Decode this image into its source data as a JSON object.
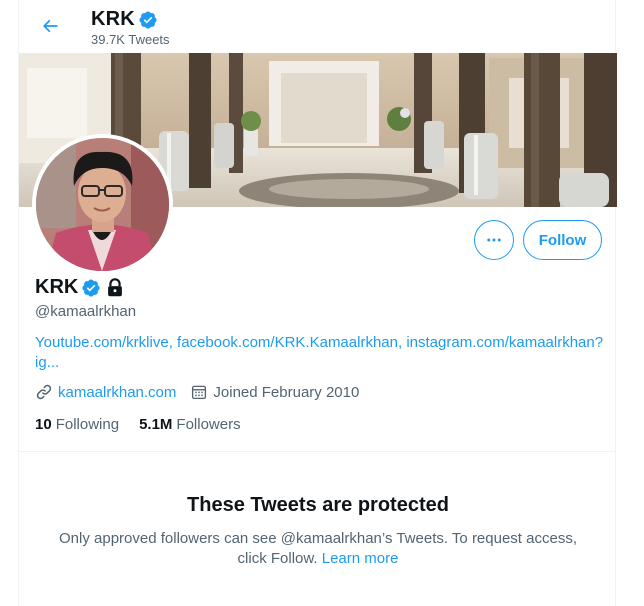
{
  "header": {
    "back_icon": "arrow-left-icon",
    "name": "KRK",
    "tweet_count": "39.7K Tweets"
  },
  "profile": {
    "name": "KRK",
    "handle": "@kamaalrkhan",
    "verified_icon": "verified-badge-icon",
    "lock_icon": "lock-icon",
    "bio_links": [
      "Youtube.com/krklive",
      "facebook.com/KRK.Kamaalrkhan",
      "instagram.com/kamaalrkhan?ig..."
    ],
    "website": "kamaalrkhan.com",
    "joined": "Joined February 2010",
    "following_count": "10",
    "following_label": "Following",
    "followers_count": "5.1M",
    "followers_label": "Followers"
  },
  "actions": {
    "more_icon": "more-icon",
    "follow_label": "Follow"
  },
  "protected": {
    "title": "These Tweets are protected",
    "message": "Only approved followers can see @kamaalrkhan’s Tweets. To request access, click Follow.",
    "learn_more": "Learn more"
  },
  "colors": {
    "accent": "#1d9bf0",
    "text": "#0f1419",
    "secondary": "#536471"
  }
}
